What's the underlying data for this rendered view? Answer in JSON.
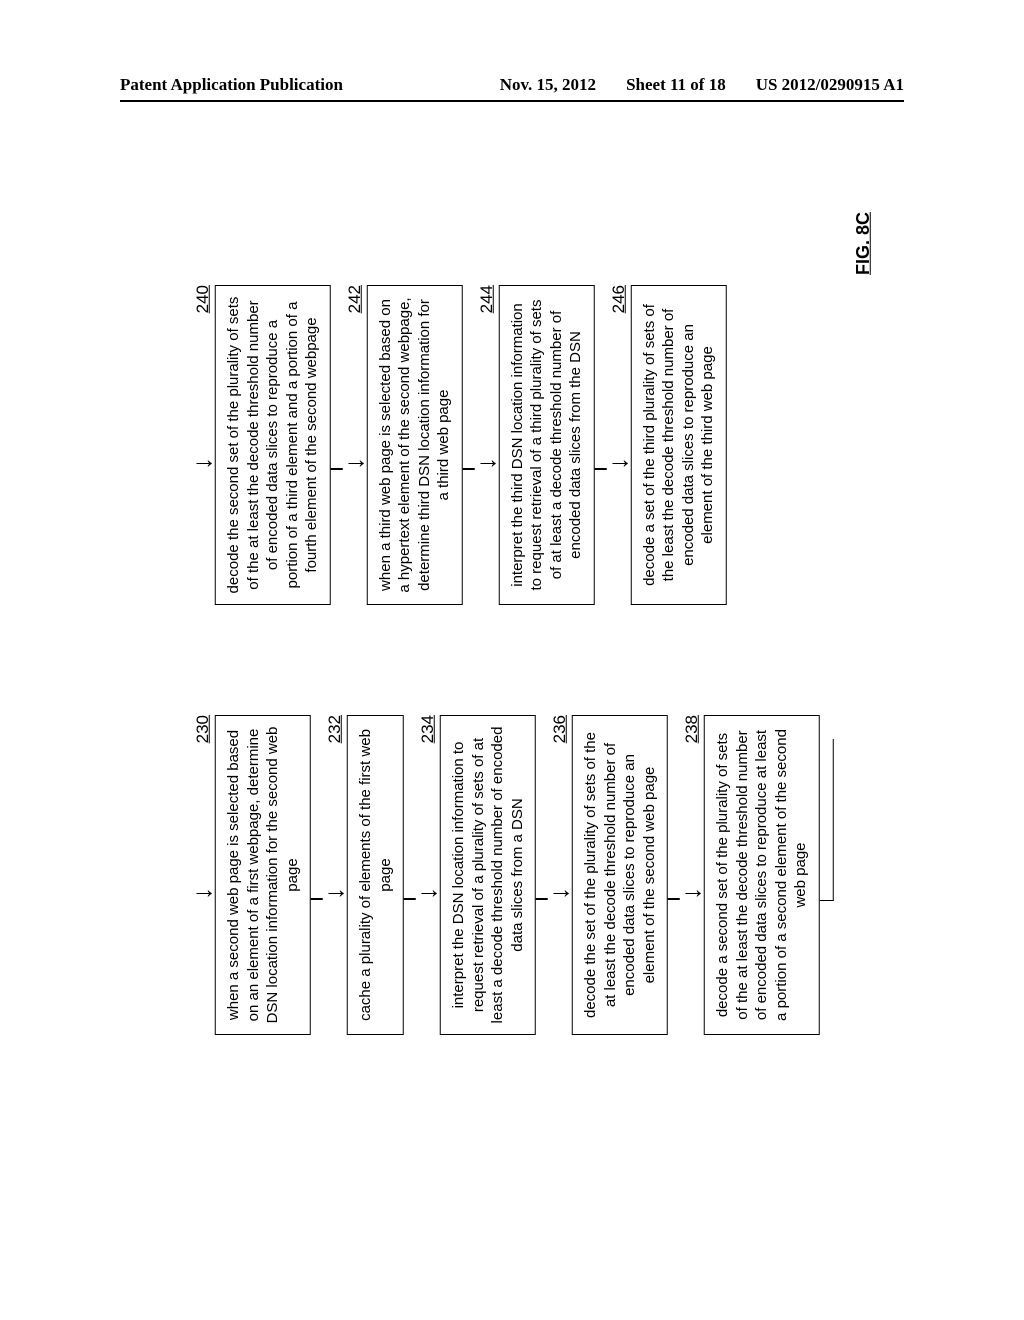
{
  "header": {
    "left": "Patent Application Publication",
    "date": "Nov. 15, 2012",
    "sheet": "Sheet 11 of 18",
    "pubno": "US 2012/0290915 A1"
  },
  "figure_label": "FIG. 8C",
  "left_column": [
    {
      "ref": "230",
      "text": "when a second web page is selected based on an element of a first webpage, determine DSN location information for the second web page"
    },
    {
      "ref": "232",
      "text": "cache a plurality of elements of the first web page"
    },
    {
      "ref": "234",
      "text": "interpret the DSN location information to request retrieval of a plurality of sets of at least a decode threshold number of encoded data slices from a DSN"
    },
    {
      "ref": "236",
      "text": "decode the set of the plurality of sets of the at least the decode threshold number of encoded data slices to reproduce an element of the second web page"
    },
    {
      "ref": "238",
      "text": "decode a second set of the plurality of sets of the at least the decode threshold number of encoded data slices to reproduce at least a portion of a second element of the second web page"
    }
  ],
  "right_column": [
    {
      "ref": "240",
      "text": "decode the second set of the plurality of sets of the at least the decode threshold number of encoded data slices to reproduce a portion of a third element and a portion of a fourth element of the second webpage"
    },
    {
      "ref": "242",
      "text": "when a third web page is selected based on a hypertext element of the second webpage, determine third DSN location information for a third web page"
    },
    {
      "ref": "244",
      "text": "interpret the third DSN location information to request retrieval of a third plurality of sets of at least a decode threshold number of encoded data slices from the DSN"
    },
    {
      "ref": "246",
      "text": "decode a set of the third plurality of sets of the least the decode threshold number of encoded data slices to reproduce an element of the third web page"
    }
  ]
}
